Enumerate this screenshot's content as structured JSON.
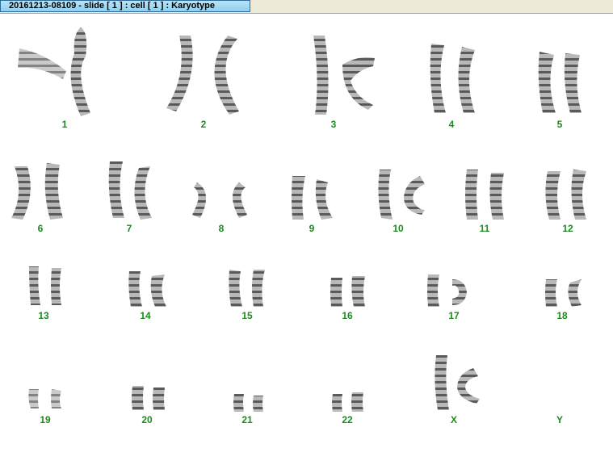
{
  "window": {
    "title": "20161213-08109 - slide [ 1 ] : cell [ 1 ] : Karyotype"
  },
  "karyotype": {
    "labels": [
      "1",
      "2",
      "3",
      "4",
      "5",
      "6",
      "7",
      "8",
      "9",
      "10",
      "11",
      "12",
      "13",
      "14",
      "15",
      "16",
      "17",
      "18",
      "19",
      "20",
      "21",
      "22",
      "X",
      "Y"
    ]
  }
}
